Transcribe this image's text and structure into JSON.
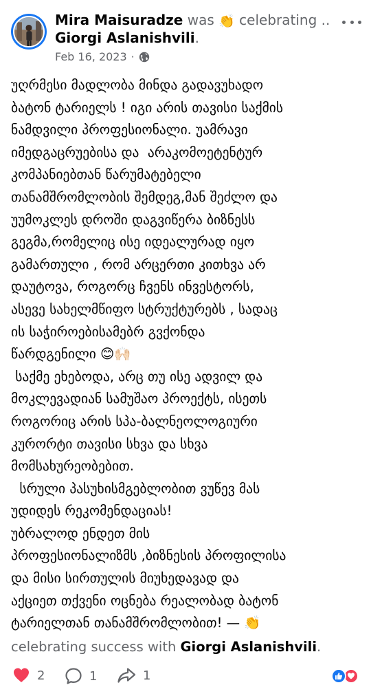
{
  "header": {
    "author": "Mira Maisuradze",
    "was_text": "was",
    "activity_emoji": "👏",
    "activity_text": "celebrating ...",
    "tagged_person": "Giorgi Aslanishvili",
    "tagged_suffix": ".",
    "date": "Feb 16, 2023",
    "separator": "·"
  },
  "post": {
    "lines": [
      "უღრმესი მადლობა მინდა გადავუხადო",
      "ბატონ ტარიელს ! იგი არის თავისი საქმის",
      "ნამდვილი პროფესიონალი. უამრავი",
      "იმედგაცრუებისა და  არაკომოეტენტურ",
      "კომპანიებთან წარუმატებელი",
      "თანამშრომლობის შემდეგ,მან შეძლო და",
      "უუმოკლეს დროში დაგვიწერა ბიზნესს",
      "გეგმა,რომელიც ისე იდეალურად იყო",
      "გამართული , რომ არცერთი კითხვა არ",
      "დაუტოვა, როგორც ჩვენს ინვესტორს,",
      "ასევე სახელმწიფო სტრუქტურებს , სადაც",
      "ის საჭიროებისამებრ გვქონდა",
      "წარდგენილი 😊🙌🏻",
      " საქმე ეხებოდა, არც თუ ისე ადვილ და",
      "მოკლევადიან სამუშაო პროექტს, ისეთს",
      "როგორიც არის სპა-ბალნეოლოგიური",
      "კურორტი თავისი სხვა და სხვა",
      "მომსახურეობებით.",
      "  სრული პასუხისმგებლობით ვუწევ მას",
      "უდიდეს რეკომენდაციას!",
      "უბრალოდ ენდეთ მის",
      "პროფესიონალიზმს ,ბიზნესის პროფილისა",
      "და მისი სირთულის მიუხედავად და",
      "აქციეთ თქვენი ოცნება რეალობად ბატონ",
      "ტარიელთან თანამშრომლობით! — 👏"
    ]
  },
  "footer": {
    "celebrating_text": "celebrating success with",
    "tagged_person": "Giorgi Aslanishvili",
    "suffix": "."
  },
  "actions": {
    "like_count": "2",
    "comment_count": "1",
    "share_count": "1"
  },
  "icons": {
    "globe": "globe-icon",
    "more": "more-options-icon",
    "like": "heart-icon",
    "comment": "comment-icon",
    "share": "share-icon"
  },
  "colors": {
    "brand_blue": "#1877f2",
    "love_red": "#f33e58",
    "muted_text": "#65676b"
  }
}
